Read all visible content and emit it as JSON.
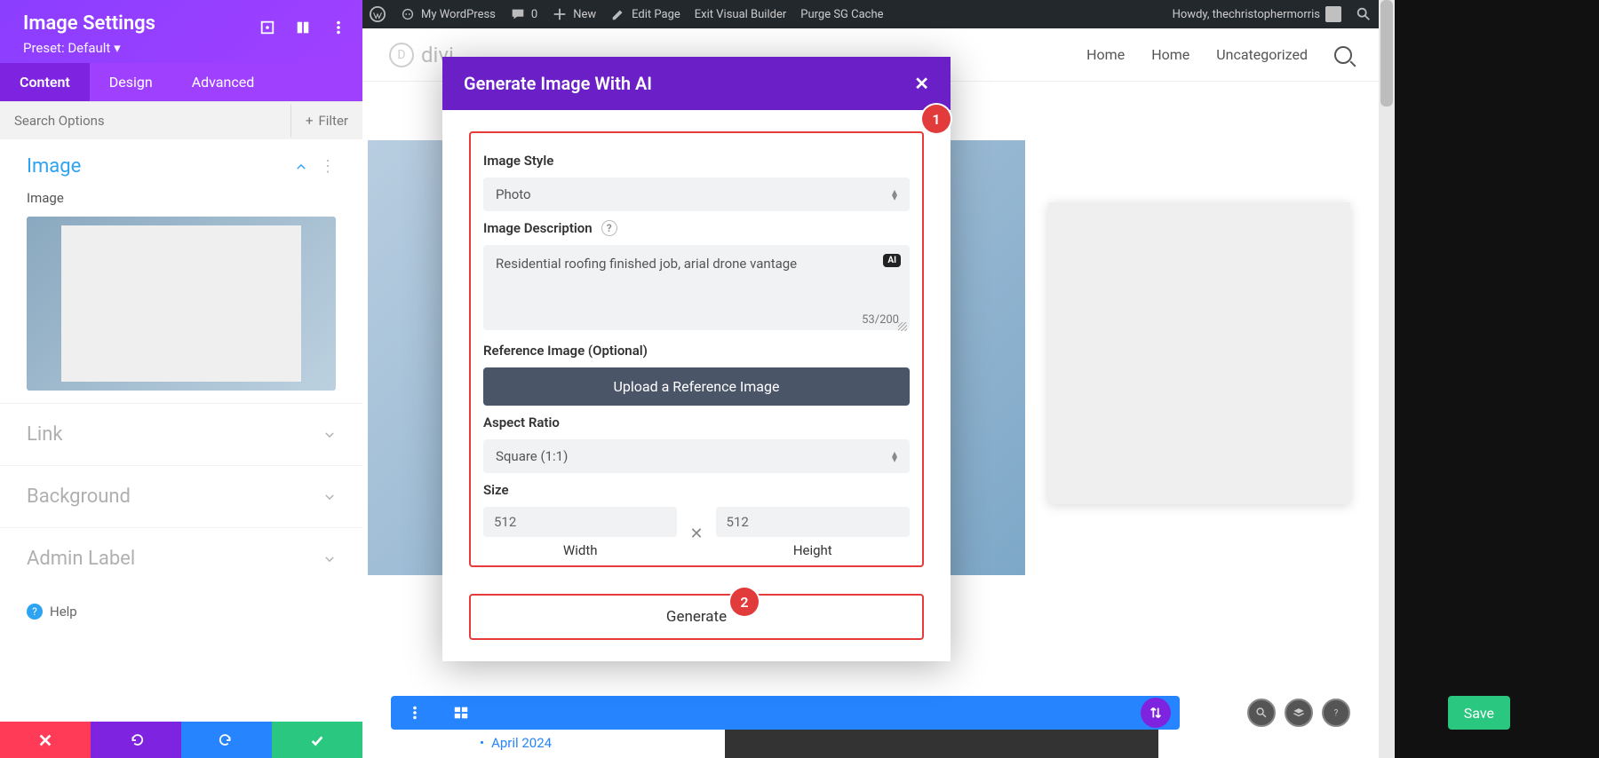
{
  "adminbar": {
    "site": "My WordPress",
    "comments": "0",
    "new": "New",
    "edit": "Edit Page",
    "exit": "Exit Visual Builder",
    "purge": "Purge SG Cache",
    "howdy": "Howdy, thechristophermorris"
  },
  "header": {
    "logo_letter": "D",
    "logo_text": "divi",
    "nav": {
      "home1": "Home",
      "home2": "Home",
      "uncat": "Uncategorized"
    }
  },
  "panel": {
    "title": "Image Settings",
    "preset": "Preset: Default",
    "tabs": {
      "content": "Content",
      "design": "Design",
      "advanced": "Advanced"
    },
    "search_placeholder": "Search Options",
    "filter": "Filter",
    "section_image": "Image",
    "label_image": "Image",
    "group_link": "Link",
    "group_background": "Background",
    "group_admin": "Admin Label",
    "help": "Help"
  },
  "modal": {
    "title": "Generate Image With AI",
    "style_label": "Image Style",
    "style_value": "Photo",
    "desc_label": "Image Description",
    "desc_value": "Residential roofing finished job, arial drone vantage",
    "char_count": "53/200",
    "ai_badge": "AI",
    "ref_label": "Reference Image (Optional)",
    "upload": "Upload a Reference Image",
    "aspect_label": "Aspect Ratio",
    "aspect_value": "Square (1:1)",
    "size_label": "Size",
    "width": "512",
    "height": "512",
    "width_label": "Width",
    "height_label": "Height",
    "generate": "Generate"
  },
  "callouts": {
    "one": "1",
    "two": "2"
  },
  "builder": {
    "save": "Save"
  },
  "archive": "April 2024"
}
